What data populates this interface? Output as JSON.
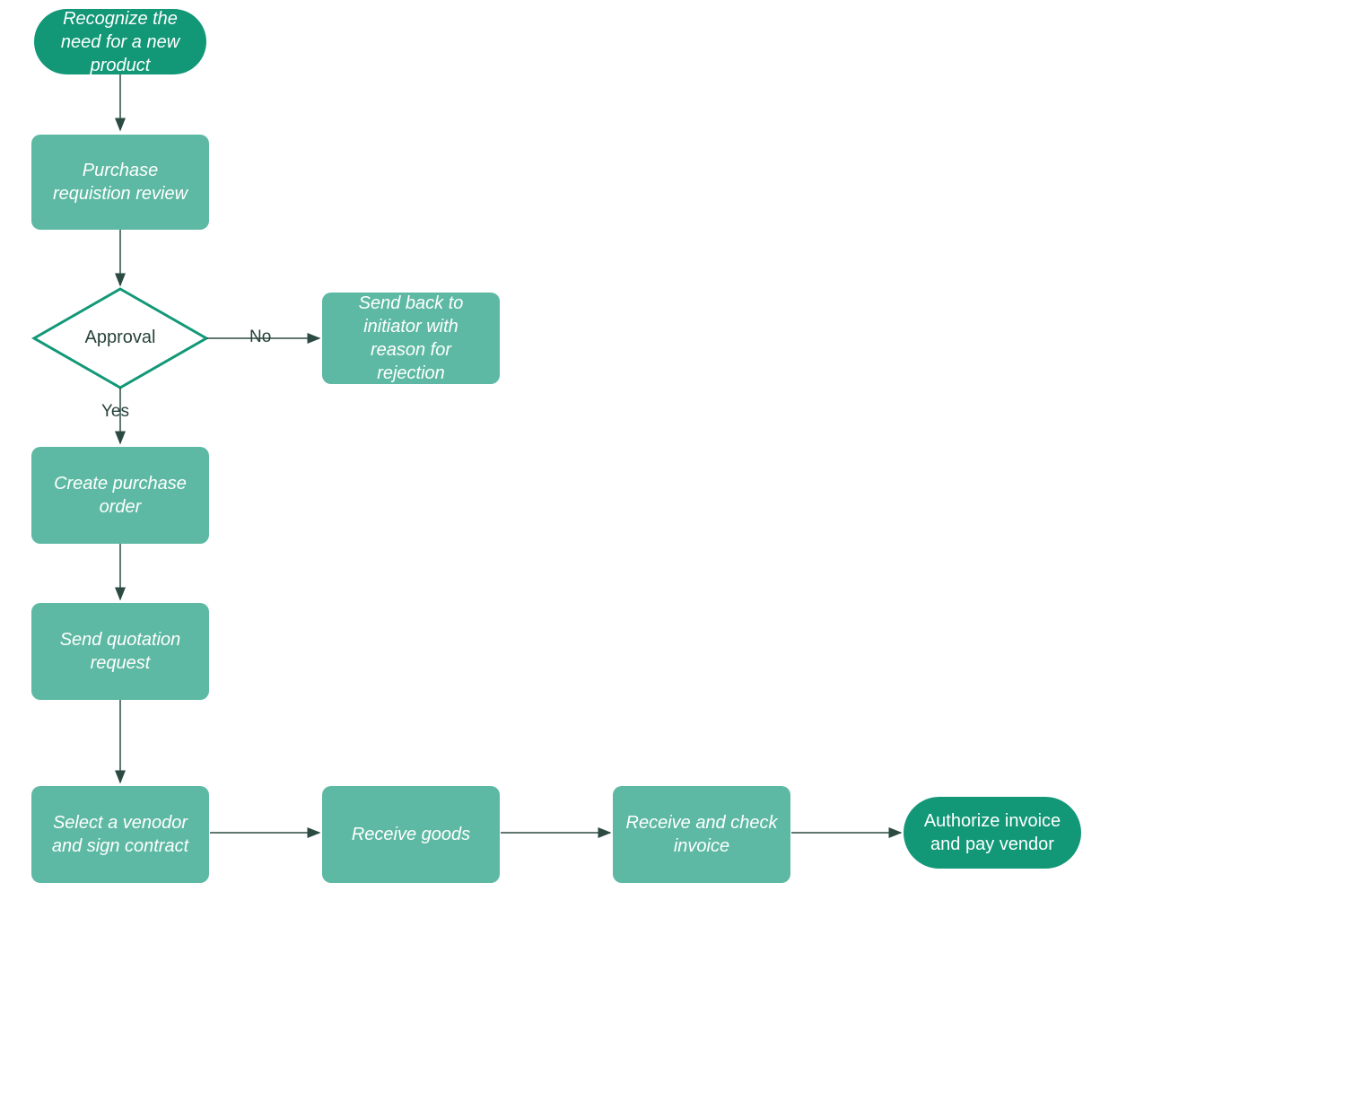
{
  "chart_data": {
    "type": "flowchart",
    "nodes": [
      {
        "id": "start",
        "type": "terminator",
        "label": "Recognize the need for a new product"
      },
      {
        "id": "review",
        "type": "process",
        "label": "Purchase requistion review"
      },
      {
        "id": "approval",
        "type": "decision",
        "label": "Approval"
      },
      {
        "id": "reject",
        "type": "process",
        "label": "Send back to initiator with reason for rejection"
      },
      {
        "id": "createpo",
        "type": "process",
        "label": "Create purchase order"
      },
      {
        "id": "quote",
        "type": "process",
        "label": "Send quotation request"
      },
      {
        "id": "vendor",
        "type": "process",
        "label": "Select a venodor and sign contract"
      },
      {
        "id": "receive",
        "type": "process",
        "label": "Receive goods"
      },
      {
        "id": "invoice",
        "type": "process",
        "label": "Receive and check invoice"
      },
      {
        "id": "pay",
        "type": "terminator",
        "label": "Authorize invoice and pay vendor"
      }
    ],
    "edges": [
      {
        "from": "start",
        "to": "review"
      },
      {
        "from": "review",
        "to": "approval"
      },
      {
        "from": "approval",
        "to": "reject",
        "label": "No"
      },
      {
        "from": "approval",
        "to": "createpo",
        "label": "Yes"
      },
      {
        "from": "createpo",
        "to": "quote"
      },
      {
        "from": "quote",
        "to": "vendor"
      },
      {
        "from": "vendor",
        "to": "receive"
      },
      {
        "from": "receive",
        "to": "invoice"
      },
      {
        "from": "invoice",
        "to": "pay"
      }
    ],
    "colors": {
      "terminator": "#129877",
      "process": "#5db9a3",
      "decisionBorder": "#129877",
      "arrow": "#2b4a42"
    }
  }
}
